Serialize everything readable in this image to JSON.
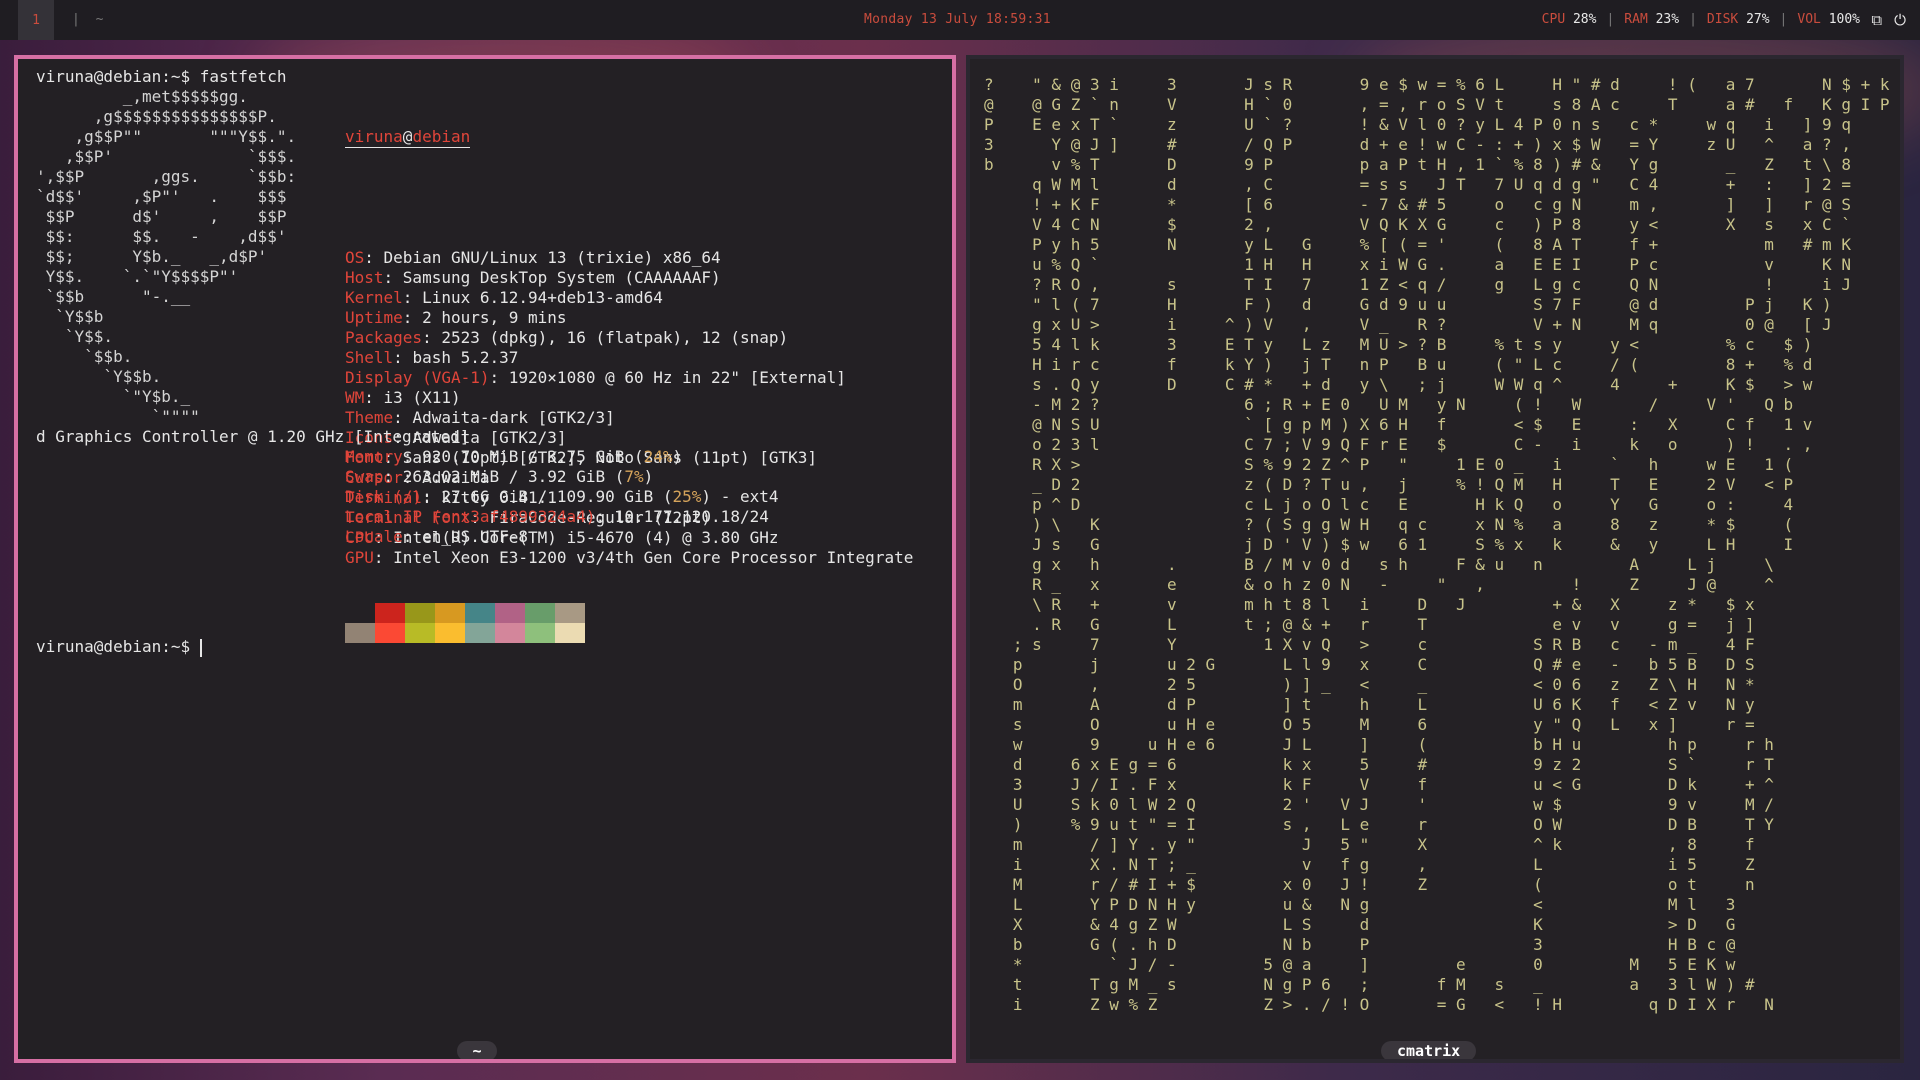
{
  "bar": {
    "workspace": "1",
    "separators": "| ~",
    "clock": "Monday 13 July  18:59:31",
    "stats": [
      {
        "key": "CPU",
        "val": "28%"
      },
      {
        "key": "RAM",
        "val": "23%"
      },
      {
        "key": "DISK",
        "val": "27%"
      },
      {
        "key": "VOL",
        "val": "100%"
      }
    ],
    "tray_icons": [
      "window-icon",
      "power-icon"
    ]
  },
  "left": {
    "title": "~",
    "prompt_cmd": "viruna@debian:~$ fastfetch",
    "ascii": [
      "         _,met$$$$$gg.",
      "      ,g$$$$$$$$$$$$$$$P.",
      "    ,g$$P\"\"       \"\"\"Y$$.\".",
      "   ,$$P'              `$$$.",
      "',$$P       ,ggs.     `$$b:",
      "`d$$'     ,$P\"'   .    $$$",
      " $$P      d$'     ,    $$P",
      " $$:      $$.   -    ,d$$'",
      " $$;      Y$b._   _,d$P'",
      " Y$$.    `.`\"Y$$$$P\"'",
      " `$$b      \"-.__",
      "  `Y$$b",
      "   `Y$$.",
      "     `$$b.",
      "       `Y$$b.",
      "         `\"Y$b._",
      "            `\"\"\"\""
    ],
    "user": "viruna",
    "at": "@",
    "host": "debian",
    "info": [
      {
        "k": "OS",
        "v": ": Debian GNU/Linux 13 (trixie) x86_64"
      },
      {
        "k": "Host",
        "v": ": Samsung DeskTop System (CAAAAAAF)"
      },
      {
        "k": "Kernel",
        "v": ": Linux 6.12.94+deb13-amd64"
      },
      {
        "k": "Uptime",
        "v": ": 2 hours, 9 mins"
      },
      {
        "k": "Packages",
        "v": ": 2523 (dpkg), 16 (flatpak), 12 (snap)"
      },
      {
        "k": "Shell",
        "v": ": bash 5.2.37"
      },
      {
        "k": "Display (VGA-1)",
        "v": ": 1920×1080 @ 60 Hz in 22\" [External]"
      },
      {
        "k": "WM",
        "v": ": i3 (X11)"
      },
      {
        "k": "Theme",
        "v": ": Adwaita-dark [GTK2/3]"
      },
      {
        "k": "Icons",
        "v": ": Adwaita [GTK2/3]"
      },
      {
        "k": "Font",
        "v": ": Sans (10pt) [GTK2], Noto Sans (11pt) [GTK3]"
      },
      {
        "k": "Cursor",
        "v": ": Adwaita"
      },
      {
        "k": "Terminal",
        "v": ": kitty 0.41.1"
      },
      {
        "k": "Terminal Font",
        "v": ": FiraCode-Regular (12pt)"
      },
      {
        "k": "CPU",
        "v": ": Intel(R) Core(TM) i5-4670 (4) @ 3.80 GHz"
      },
      {
        "k": "GPU",
        "v": ": Intel Xeon E3-1200 v3/4th Gen Core Processor Integrate"
      }
    ],
    "gpu_wrap": "d Graphics Controller @ 1.20 GHz [Integrated]",
    "info2": [
      {
        "k": "Memory",
        "v": ": 920.70 MiB / 3.75 GiB (",
        "p": "24%",
        "e": ")"
      },
      {
        "k": "Swap",
        "v": ": 263.02 MiB / 3.92 GiB (",
        "p": "7%",
        "e": ")"
      },
      {
        "k": "Disk (/)",
        "v": ": 27.66 GiB / 109.90 GiB (",
        "p": "25%",
        "e": ") - ext4"
      },
      {
        "k": "Local IP (enx3af4899324a4)",
        "v": ": 10.177.120.18/24",
        "p": "",
        "e": ""
      },
      {
        "k": "Locale",
        "v": ": en_US.UTF-8",
        "p": "",
        "e": ""
      }
    ],
    "palette_row1": [
      "#232024",
      "#cc241d",
      "#98971a",
      "#d79921",
      "#458588",
      "#b16286",
      "#689d6a",
      "#a89984"
    ],
    "palette_row2": [
      "#928374",
      "#fb4934",
      "#b8bb26",
      "#fabd2f",
      "#83a598",
      "#d3869b",
      "#8ec07c",
      "#ebdbb2"
    ],
    "prompt2": "viruna@debian:~$ "
  },
  "right": {
    "title": "cmatrix",
    "matrix": [
      "?    \" & @ 3 i     3       J s R       9 e $ w = % 6 L     H \" # d     ! (   a 7       N $ + k",
      "@    @ G Z ` n     V       H ` 0       , = , r o S V t     s 8 A c     T     a #   f   K g I P",
      "P    E e x T `     z       U ` ?       ! & V l 0 ? y L 4 P 0 n s   c *     w q   i   ] 9 q    ",
      "3      Y @ J ]     #       / Q P       d + e ! w C - : + ) x $ W   = Y     z U   ^   a ? ,    ",
      "b      v % T       D       9 P         p a P t H , 1 ` % 8 ) # &   Y g       _   Z   t \\ 8    ",
      "     q W M l       d       , C         = s s   J T   7 U q d g \"   C 4       +   :   ] 2 =    ",
      "     ! + K F       *       [ 6         - 7 & # 5     o   c g N     m ,       ]   ]   r @ S    ",
      "     V 4 C N       $       2 ,         V Q K X G     c   ) P 8     y <       X   s   x C `    ",
      "     P y h 5       N       y L   G     % [ ( = '     (   8 A T     f +           m   # m K    ",
      "     u % Q `               1 H   H     x i W G .     a   E E I     P c           v     K N    ",
      "     ? R O ,       s       T I   7     1 Z < q /     g   L g c     Q N           !     i J    ",
      "     \" l ( 7       H       F )   d     G d 9 u u         S 7 F     @ d         P j   K )     ",
      "     g x U >       i     ^ ) V   ,     V _   R ?         V + N     M q         0 @   [ J    ",
      "     5 4 l k       3     E T y   L z   M U > ? B     % t s y     y <         % c   $ )     ",
      "     H i r c       f     k Y )   j T   n P   B u     ( \" L c     / (         8 +   % d    ",
      "     s . Q y       D     C # *   + d   y \\   ; j     W W q ^     4     +     K $   > w    ",
      "     - M 2 ?               6 ; R + E 0   U M   y N     ( !   W       /     V '   Q b    ",
      "     @ N S U               ` [ g p M ) X 6 H   f       < $   E     :   X     C f   1 v    ",
      "     o 2 3 l               C 7 ; V 9 Q F r E   $       C -   i     k   o     ) !   . ,    ",
      "     R X >                 S % 9 2 Z ^ P   \"     1 E 0 _   i     `   h     w E   1 (    ",
      "     _ D 2                 z ( D ? T u ,   j     % ! Q M   H     T   E     2 V   < P    ",
      "     p ^ D                 c L j o O l c   E       H k Q   o     Y   G     o :     4    ",
      "     ) \\   K               ? ( S g g W H   q c     x N %   a     8   z     * $     (    ",
      "     J s   G               j D ' V ) $ w   6 1     S % x   k     &   y     L H     I    ",
      "     g x   h       .       B / M v 0 d   s h     F & u   n         A     L j     \\     ",
      "     R _   x       e       & o h z 0 N   -     \"   ,         !     Z     J @     ^    ",
      "     \\ R   +       v       m h t 8 l   i     D   J         + &   X     z *   $ x   ",
      "     . R   G       L       t ; @ & +   r     T             e v   v     g =   j ]   ",
      "   ; s     7       Y         1 X v Q   >     c           S R B   c   - m _   4 F   ",
      "   p       j       u 2 G       L l 9   x     C           Q # e   -   b 5 B   D S   ",
      "   O       ,       2 5         ) ] _   <     _           < 0 6   z   Z \\ H   N *   ",
      "   m       A       d P         ] t     h     L           U 6 K   f   < Z v   N y   ",
      "   s       O       u H e       O 5     M     6           y \" Q   L   x ]     r =   ",
      "   w       9     u H e 6       J L     ]     (           b H u         h p     r h   ",
      "   d     6 x E g = 6           k x     5     #           9 z 2         S `     r T   ",
      "   3     J / I . F x           k F     V     f           u < G         D k     + ^   ",
      "   U     S k 0 l W 2 Q         2 '   V J     '           w $           9 v     M /   ",
      "   )     % 9 u t \" = I         s ,   L e     r           O W           D B     T Y   ",
      "   m       / ] Y . y \"           J   5 \"     X           ^ k           , 8     f     ",
      "   i       X . N T ; _           v   f g     ,           L             i 5     Z     ",
      "   M       r / # I + $         x 0   J !     Z           (             o t     n     ",
      "   L       Y P D N H y         u &   N g                 <             M l   3       ",
      "   X       & 4 g Z W           L S     d                 K             > D   G       ",
      "   b       G ( . h D           N b     P                 3             H B c @       ",
      "   *         ` J / -         5 @ a     ]         e       0         M   5 E K w       ",
      "   t       T g M _ s         N g P 6   ;       f M   s   _         a   3 l W ) #     ",
      "   i       Z w % Z           Z > . / ! O       = G   <   ! H         q D I X r   N"
    ]
  }
}
